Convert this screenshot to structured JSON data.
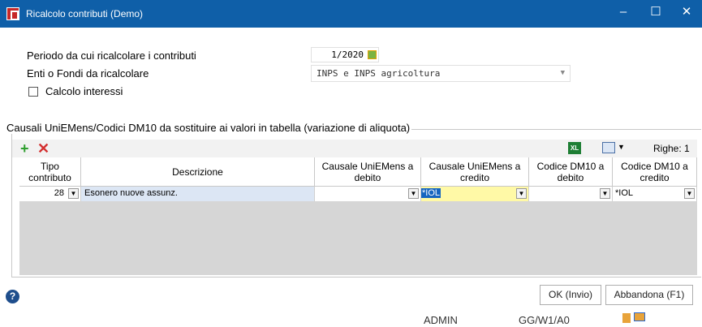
{
  "window": {
    "title": "Ricalcolo contributi  (Demo)",
    "min_glyph": "–",
    "max_glyph": "☐",
    "close_glyph": "✕"
  },
  "form": {
    "period_label": "Periodo da cui ricalcolare i contributi",
    "period_value": "1/2020",
    "enti_label": "Enti o Fondi da ricalcolare",
    "enti_value": "INPS e INPS agricoltura",
    "interessi_label": "Calcolo interessi",
    "interessi_checked": false
  },
  "group": {
    "title": "Causali UniEMens/Codici DM10 da sostituire ai valori in tabella (variazione di aliquota)",
    "toolbar": {
      "add_glyph": "+",
      "delete_glyph": "✕",
      "excel_glyph": "XL",
      "righe_label": "Righe: 1"
    }
  },
  "grid": {
    "columns": [
      "Tipo contributo",
      "Descrizione",
      "Causale UniEMens a debito",
      "Causale UniEMens a credito",
      "Codice DM10 a debito",
      "Codice DM10 a credito"
    ],
    "rows": [
      {
        "tipo": "28",
        "descrizione": "Esonero nuove assunz.",
        "causale_debito": "",
        "causale_credito": "*IOL",
        "dm10_debito": "",
        "dm10_credito": "*IOL"
      }
    ]
  },
  "footer": {
    "help_glyph": "?",
    "ok_label": "OK (Invio)",
    "abort_label": "Abbandona (F1)"
  },
  "statusbar": {
    "user": "ADMIN",
    "code": "GG/W1/A0"
  },
  "colors": {
    "titlebar": "#0f5fa8",
    "selected_cell": "#fff9a6",
    "selected_text_bg": "#1565c0",
    "row_highlight": "#dce6f4"
  }
}
